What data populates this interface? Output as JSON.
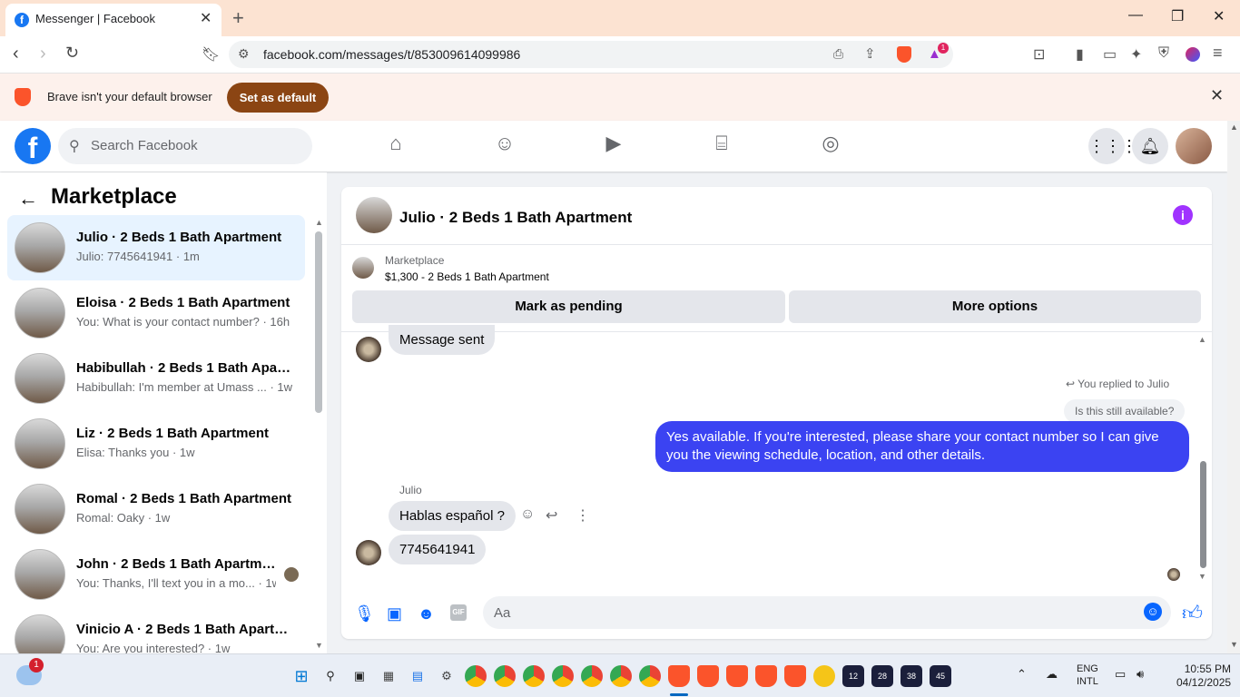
{
  "browser": {
    "tab_title": "Messenger | Facebook",
    "url": "facebook.com/messages/t/853009614099986",
    "notification_count": "1",
    "infobar_message": "Brave isn't your default browser",
    "infobar_button": "Set as default"
  },
  "fb": {
    "search_placeholder": "Search Facebook"
  },
  "sidebar": {
    "heading": "Marketplace",
    "conversations": [
      {
        "name": "Julio · 2 Beds 1 Bath Apartment",
        "snippet": "Julio: 7745641941 · 1m"
      },
      {
        "name": "Eloisa · 2 Beds 1 Bath Apartment",
        "snippet": "You: What is your contact number? · 16h"
      },
      {
        "name": "Habibullah · 2 Beds 1 Bath Apart...",
        "snippet": "Habibullah: I'm member at Umass ... · 1w"
      },
      {
        "name": "Liz · 2 Beds 1 Bath Apartment",
        "snippet": "Elisa: Thanks you · 1w"
      },
      {
        "name": "Romal · 2 Beds 1 Bath Apartment",
        "snippet": "Romal: Oaky · 1w"
      },
      {
        "name": "John · 2 Beds 1 Bath Apartment",
        "snippet": "You: Thanks, I'll text you in a mo... · 1w"
      },
      {
        "name": "Vinicio A · 2 Beds 1 Bath Apartm...",
        "snippet": "You: Are you interested? · 1w"
      }
    ]
  },
  "chat": {
    "title": "Julio · 2 Beds 1 Bath Apartment",
    "listing_category": "Marketplace",
    "listing_price": "$1,300 - 2 Beds 1 Bath Apartment",
    "mark_pending": "Mark as pending",
    "more_options": "More options",
    "msg_sent": "Message sent",
    "replied_label": "You replied to Julio",
    "quoted": "Is this still available?",
    "my_reply": "Yes available. If you're interested, please share your contact number so I can give you the viewing schedule, location, and other details.",
    "sender_name": "Julio",
    "msg_spanish": "Hablas español ?",
    "msg_number": "7745641941",
    "composer_placeholder": "Aa",
    "gif_label": "GIF"
  },
  "taskbar": {
    "weather_badge": "1",
    "lang_1": "ENG",
    "lang_2": "INTL",
    "time": "10:55 PM",
    "date": "04/12/2025",
    "badge_12": "12",
    "badge_28": "28",
    "badge_38": "38",
    "badge_45": "45"
  },
  "colors": {
    "fb_blue": "#1877f2",
    "my_bubble": "#3b43f2",
    "brave_orange": "#fb542b",
    "set_default_bg": "#8b4513"
  }
}
